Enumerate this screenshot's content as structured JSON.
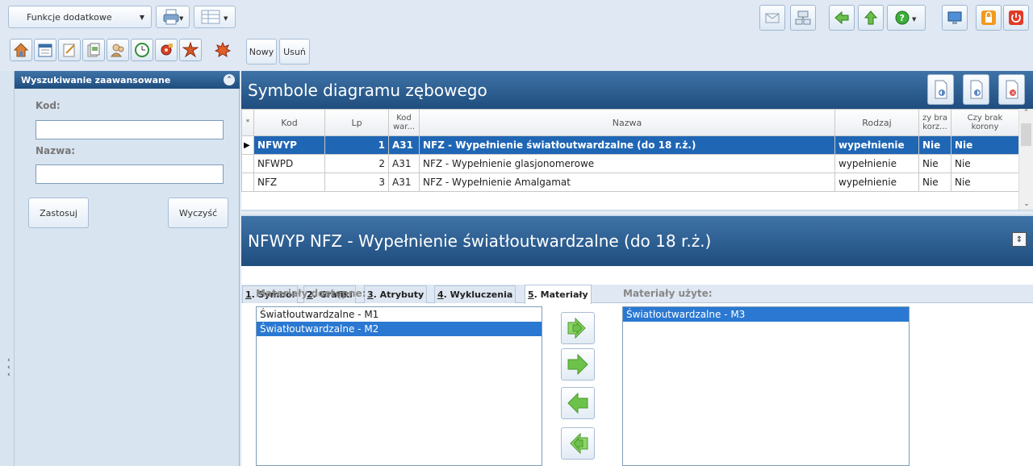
{
  "toolbar": {
    "funkcje_label": "Funkcje dodatkowe",
    "nowy_label": "Nowy",
    "usun_label": "Usuń"
  },
  "search_panel": {
    "title": "Wyszukiwanie zaawansowane",
    "kod_label": "Kod:",
    "kod_value": "",
    "nazwa_label": "Nazwa:",
    "nazwa_value": "",
    "apply_label": "Zastosuj",
    "clear_label": "Wyczyść"
  },
  "grid": {
    "title": "Symbole diagramu zębowego",
    "columns": [
      "*",
      "Kod",
      "Lp",
      "Kod war...",
      "Nazwa",
      "Rodzaj",
      "zy bra korz...",
      "Czy brak korony"
    ],
    "rows": [
      {
        "kod": "NFWYP",
        "lp": "1",
        "kodwar": "A31",
        "nazwa": "NFZ - Wypełnienie światłoutwardzalne (do 18 r.ż.)",
        "rodzaj": "wypełnienie",
        "c1": "Nie",
        "c2": "Nie"
      },
      {
        "kod": "NFWPD",
        "lp": "2",
        "kodwar": "A31",
        "nazwa": "NFZ - Wypełnienie glasjonomerowe",
        "rodzaj": "wypełnienie",
        "c1": "Nie",
        "c2": "Nie"
      },
      {
        "kod": "NFZ",
        "lp": "3",
        "kodwar": "A31",
        "nazwa": "NFZ - Wypełnienie Amalgamat",
        "rodzaj": "wypełnienie",
        "c1": "Nie",
        "c2": "Nie"
      }
    ],
    "selected_row": 0
  },
  "detail": {
    "title": "NFWYP NFZ - Wypełnienie światłoutwardzalne (do 18 r.ż.)",
    "tabs": [
      {
        "key": "1",
        "label": ". Symbol"
      },
      {
        "key": "2",
        "label": ". Grafiki"
      },
      {
        "key": "3",
        "label": ". Atrybuty"
      },
      {
        "key": "4",
        "label": ". Wykluczenia"
      },
      {
        "key": "5",
        "label": ". Materiały"
      }
    ],
    "active_tab": 4,
    "available_label": "Materiały dostępne:",
    "available": [
      "Światłoutwardzalne - M1",
      "Światłoutwardzalne - M2"
    ],
    "available_selected": 1,
    "used_label": "Materiały użyte:",
    "used": [
      "Światłoutwardzalne - M3"
    ],
    "used_selected": 0
  },
  "colors": {
    "header_blue": "#1f4d7e",
    "selection_blue": "#1f66b5",
    "arrow_green": "#6cc24a"
  }
}
